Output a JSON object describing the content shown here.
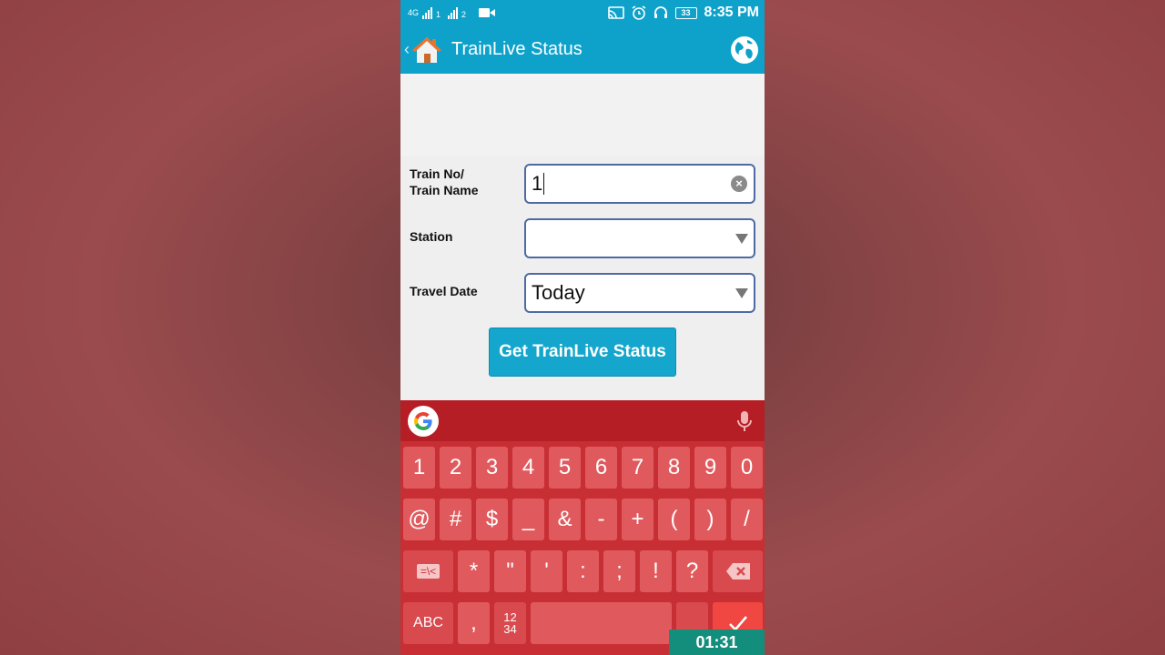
{
  "statusbar": {
    "network": "4G",
    "sim1": "1",
    "sim2": "2",
    "battery": "33",
    "time": "8:35 PM"
  },
  "appbar": {
    "title": "TrainLive Status"
  },
  "form": {
    "train_label_1": "Train No/",
    "train_label_2": "Train Name",
    "train_value": "1",
    "station_label": "Station",
    "station_value": "",
    "date_label": "Travel Date",
    "date_value": "Today",
    "submit_label": "Get TrainLive Status"
  },
  "keyboard": {
    "row1": [
      "1",
      "2",
      "3",
      "4",
      "5",
      "6",
      "7",
      "8",
      "9",
      "0"
    ],
    "row2": [
      "@",
      "#",
      "$",
      "_",
      "&",
      "-",
      "+",
      "(",
      ")",
      "/"
    ],
    "row3": [
      "*",
      "\"",
      "'",
      ":",
      ";",
      "!",
      "?"
    ],
    "symbols_key": "=\\<",
    "abc_label": "ABC",
    "comma": ",",
    "numpad_top": "12",
    "numpad_bottom": "34"
  },
  "timer": "01:31",
  "colors": {
    "appbar": "#0ea2cb",
    "keyboard": "#c82f35",
    "key": "#e05a5d",
    "field_border": "#4e6aa4",
    "timer": "#138e7c"
  }
}
